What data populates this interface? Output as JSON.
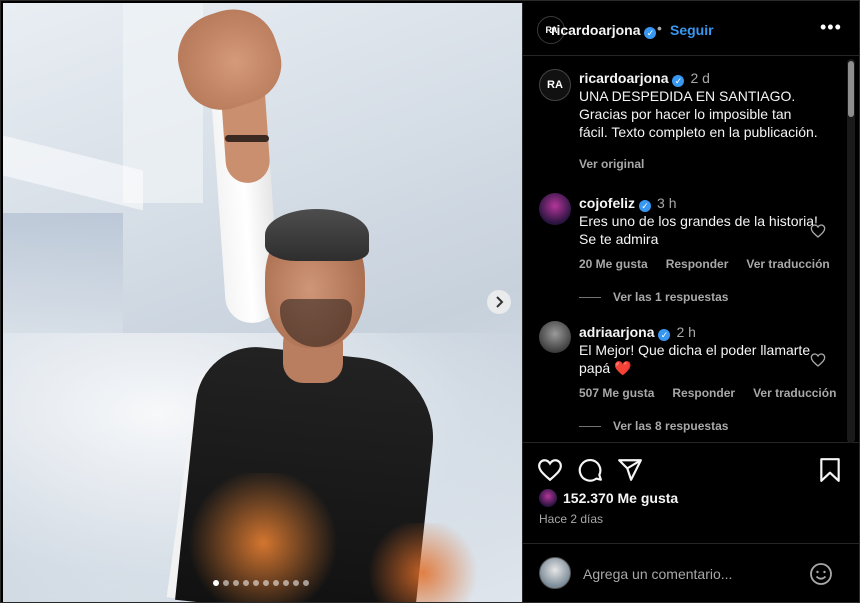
{
  "post": {
    "carousel_total": 10,
    "carousel_current": 1
  },
  "header": {
    "username": "ricardoarjona",
    "separator": "•",
    "follow_label": "Seguir",
    "more_label": "•••",
    "avatar_logo": "RA"
  },
  "caption": {
    "username": "ricardoarjona",
    "time": "2 d",
    "text": "UNA DESPEDIDA EN SANTIAGO. Gracias por hacer lo imposible tan fácil. Texto completo en la publicación.",
    "see_original": "Ver original",
    "avatar_logo": "RA"
  },
  "comments": [
    {
      "username": "cojofeliz",
      "time": "3 h",
      "text": "Eres uno de los grandes de la historia! Se te admira",
      "likes": "20 Me gusta",
      "reply_label": "Responder",
      "translate_label": "Ver traducción",
      "replies_label": "Ver las 1 respuestas"
    },
    {
      "username": "adriaarjona",
      "time": "2 h",
      "text": "El Mejor! Que dicha el poder llamarte papá ❤️",
      "likes": "507 Me gusta",
      "reply_label": "Responder",
      "translate_label": "Ver traducción",
      "replies_label": "Ver las 8 respuestas"
    }
  ],
  "stats": {
    "likes": "152.370 Me gusta",
    "posted_ago": "Hace 2 días"
  },
  "composer": {
    "placeholder": "Agrega un comentario..."
  },
  "icons": {
    "verified": "verified-badge-icon",
    "like": "heart-icon",
    "comment": "comment-bubble-icon",
    "share": "paper-plane-icon",
    "save": "bookmark-icon",
    "emoji": "smiley-icon",
    "next": "chevron-right-icon"
  },
  "colors": {
    "accent": "#3897f0",
    "background": "#000000",
    "text": "#f5f5f5",
    "secondary_text": "#a8a8a8",
    "heart_red": "#ed4956"
  }
}
